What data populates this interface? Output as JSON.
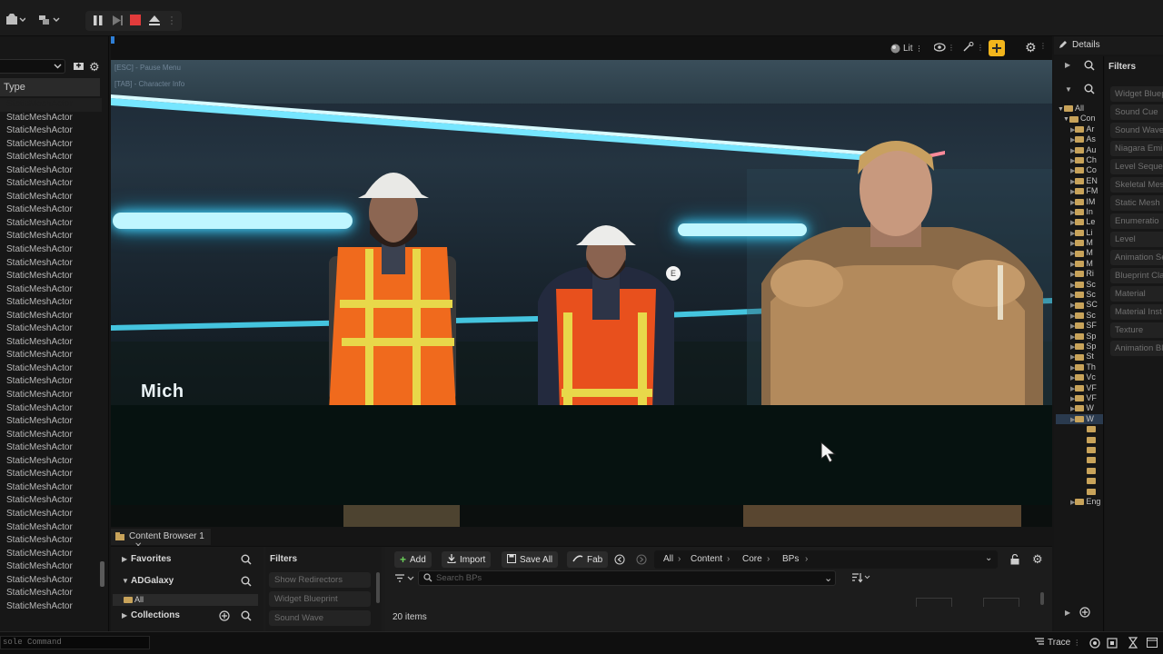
{
  "toolbar": {
    "icons": [
      "camera-icon",
      "blueprint-icon",
      "pause-icon",
      "skip-frame-icon",
      "stop-icon",
      "eject-icon"
    ],
    "stop_color": "#e23b3b"
  },
  "outliner": {
    "type_header": "Type",
    "rows": [
      "StaticMeshActor",
      "StaticMeshActor",
      "StaticMeshActor",
      "StaticMeshActor",
      "StaticMeshActor",
      "StaticMeshActor",
      "StaticMeshActor",
      "StaticMeshActor",
      "StaticMeshActor",
      "StaticMeshActor",
      "StaticMeshActor",
      "StaticMeshActor",
      "StaticMeshActor",
      "StaticMeshActor",
      "StaticMeshActor",
      "StaticMeshActor",
      "StaticMeshActor",
      "StaticMeshActor",
      "StaticMeshActor",
      "StaticMeshActor",
      "StaticMeshActor",
      "StaticMeshActor",
      "StaticMeshActor",
      "StaticMeshActor",
      "StaticMeshActor",
      "StaticMeshActor",
      "StaticMeshActor",
      "StaticMeshActor",
      "StaticMeshActor",
      "StaticMeshActor",
      "StaticMeshActor",
      "StaticMeshActor",
      "StaticMeshActor",
      "StaticMeshActor",
      "StaticMeshActor",
      "StaticMeshActor",
      "StaticMeshActor",
      "StaticMeshActor",
      "StaticMeshActor"
    ]
  },
  "viewport": {
    "lit_label": "Lit",
    "hud_line_1": "[ESC] - Pause Menu",
    "hud_line_2": "[TAB] - Character Info",
    "interact_key": "E",
    "speaker_name": "Mich",
    "accent_yellow": "#f2b51c"
  },
  "details": {
    "tab_label": "Details",
    "filters_label": "Filters",
    "filter_items": [
      "Widget Bluep",
      "Sound Cue",
      "Sound Wave",
      "Niagara Emi",
      "Level Seque",
      "Skeletal Mes",
      "Static Mesh",
      "Enumeratio",
      "Level",
      "Animation Se",
      "Blueprint Cla",
      "Material",
      "Material Inst",
      "Texture",
      "Animation Bl"
    ],
    "tree_root": "All",
    "tree_content": "Con",
    "tree_children": [
      "Ar",
      "As",
      "Au",
      "Ch",
      "Co",
      "EN",
      "FM",
      "IM",
      "In",
      "Le",
      "Li",
      "M",
      "M",
      "M",
      "Ri",
      "Sc",
      "Sc",
      "SC",
      "Sc",
      "SF",
      "Sp",
      "Sp",
      "St",
      "Th",
      "Vc",
      "VF",
      "VF",
      "W",
      "W"
    ],
    "tree_engine": "Eng"
  },
  "content_browser": {
    "tab_label": "Content Browser 1",
    "favorites": "Favorites",
    "project": "ADGalaxy",
    "all": "All",
    "collections": "Collections",
    "filters": "Filters",
    "filter_chips": [
      "Show Redirectors",
      "Widget Blueprint",
      "Sound Wave"
    ],
    "add": "Add",
    "import": "Import",
    "save_all": "Save All",
    "fab": "Fab",
    "breadcrumb": [
      "All",
      "Content",
      "Core",
      "BPs"
    ],
    "search_placeholder": "Search BPs",
    "item_count": "20 items"
  },
  "statusbar": {
    "console_placeholder": "sole Command",
    "trace": "Trace"
  }
}
